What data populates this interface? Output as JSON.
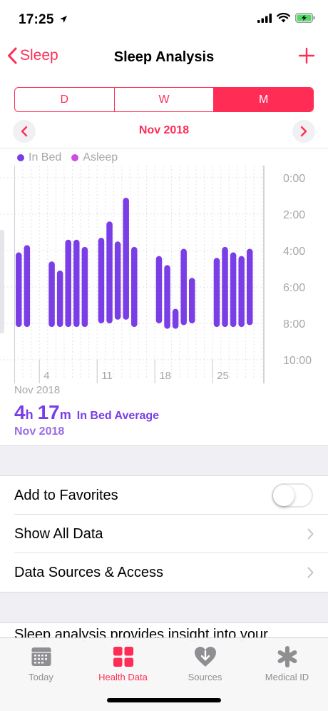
{
  "status": {
    "time": "17:25"
  },
  "nav": {
    "back_label": "Sleep",
    "title": "Sleep Analysis"
  },
  "segments": [
    {
      "label": "D",
      "active": false
    },
    {
      "label": "W",
      "active": false
    },
    {
      "label": "M",
      "active": true
    }
  ],
  "month": "Nov 2018",
  "legend": [
    {
      "label": "In Bed",
      "color": "#7a3ee6"
    },
    {
      "label": "Asleep",
      "color": "#d04ce0"
    }
  ],
  "chart_data": {
    "type": "bar",
    "x_ticks": [
      "4",
      "11",
      "18",
      "25"
    ],
    "y_ticks": [
      "0:00",
      "2:00",
      "4:00",
      "6:00",
      "8:00",
      "10:00"
    ],
    "ylim": [
      0,
      10
    ],
    "bar_color": "#7a3ee6",
    "series": [
      {
        "name": "In Bed",
        "bars": [
          {
            "day": 1,
            "start": 4.1,
            "end": 8.2
          },
          {
            "day": 2,
            "start": 3.7,
            "end": 8.2
          },
          {
            "day": 5,
            "start": 4.6,
            "end": 8.2
          },
          {
            "day": 6,
            "start": 5.1,
            "end": 8.2
          },
          {
            "day": 7,
            "start": 3.4,
            "end": 8.2
          },
          {
            "day": 8,
            "start": 3.4,
            "end": 8.2
          },
          {
            "day": 9,
            "start": 3.8,
            "end": 8.2
          },
          {
            "day": 11,
            "start": 3.3,
            "end": 8.0
          },
          {
            "day": 12,
            "start": 2.4,
            "end": 8.0
          },
          {
            "day": 13,
            "start": 3.5,
            "end": 7.8
          },
          {
            "day": 14,
            "start": 1.1,
            "end": 7.8
          },
          {
            "day": 15,
            "start": 3.8,
            "end": 8.2
          },
          {
            "day": 18,
            "start": 4.3,
            "end": 8.0
          },
          {
            "day": 19,
            "start": 4.8,
            "end": 8.3
          },
          {
            "day": 20,
            "start": 7.2,
            "end": 8.3
          },
          {
            "day": 21,
            "start": 3.9,
            "end": 8.1
          },
          {
            "day": 22,
            "start": 5.5,
            "end": 8.0
          },
          {
            "day": 25,
            "start": 4.4,
            "end": 8.2
          },
          {
            "day": 26,
            "start": 3.8,
            "end": 8.2
          },
          {
            "day": 27,
            "start": 4.1,
            "end": 8.2
          },
          {
            "day": 28,
            "start": 4.3,
            "end": 8.2
          },
          {
            "day": 29,
            "start": 3.9,
            "end": 8.1
          }
        ]
      }
    ]
  },
  "summary": {
    "period_label": "Nov 2018",
    "hours": "4",
    "hours_unit": "h",
    "minutes": "17",
    "minutes_unit": "m",
    "avg_label": "In Bed Average",
    "period_sub": "Nov 2018"
  },
  "list": {
    "favorites_label": "Add to Favorites",
    "favorites_on": false,
    "show_all_label": "Show All Data",
    "sources_label": "Data Sources & Access"
  },
  "description": "Sleep analysis provides insight into your",
  "tabs": [
    {
      "label": "Today",
      "icon": "calendar-icon",
      "active": false
    },
    {
      "label": "Health Data",
      "icon": "grid-icon",
      "active": true
    },
    {
      "label": "Sources",
      "icon": "heart-download-icon",
      "active": false
    },
    {
      "label": "Medical ID",
      "icon": "asterisk-icon",
      "active": false
    }
  ],
  "colors": {
    "accent": "#ff2d55",
    "sleep": "#7a3ee6"
  }
}
